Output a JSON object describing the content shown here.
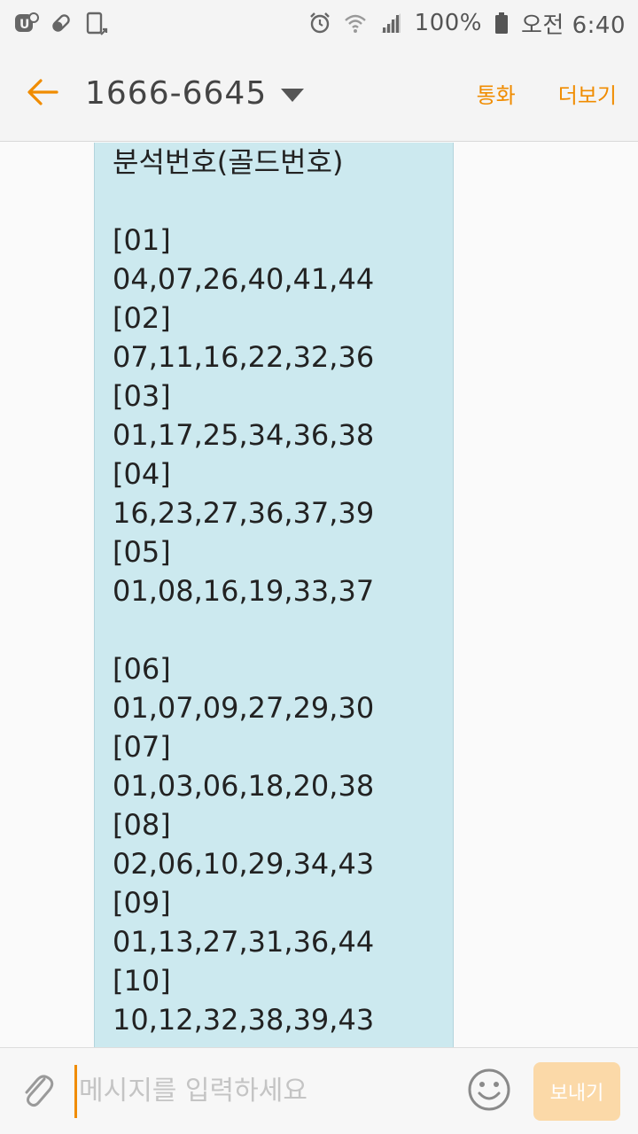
{
  "status_bar": {
    "battery": "100%",
    "time": "오전 6:40",
    "left_icons": [
      "app-badge-icon",
      "pill-icon",
      "phone-upload-icon"
    ],
    "right_icons": [
      "alarm-icon",
      "wifi-icon",
      "signal-icon",
      "battery-icon"
    ]
  },
  "header": {
    "title": "1666-6645",
    "call_label": "통화",
    "more_label": "더보기"
  },
  "message": {
    "lines": [
      "분석번호(골드번호)",
      "",
      "[01]",
      "04,07,26,40,41,44",
      "[02]",
      "07,11,16,22,32,36",
      "[03]",
      "01,17,25,34,36,38",
      "[04]",
      "16,23,27,36,37,39",
      "[05]",
      "01,08,16,19,33,37",
      "",
      "[06]",
      "01,07,09,27,29,30",
      "[07]",
      "01,03,06,18,20,38",
      "[08]",
      "02,06,10,29,34,43",
      "[09]",
      "01,13,27,31,36,44",
      "[10]",
      "10,12,32,38,39,43"
    ]
  },
  "composer": {
    "placeholder": "메시지를 입력하세요",
    "send_label": "보내기"
  },
  "colors": {
    "accent": "#f08c00",
    "bubble": "#cce9ef",
    "send_disabled": "#fbd9a8"
  }
}
